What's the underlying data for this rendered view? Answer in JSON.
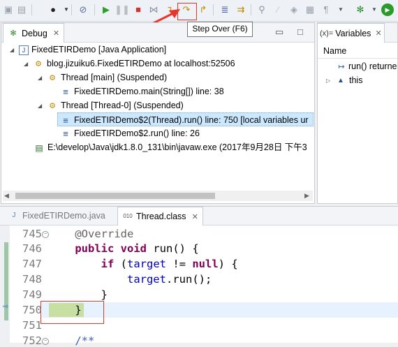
{
  "toolbar": {
    "tooltip": "Step Over (F6)",
    "icons": [
      "save-icon",
      "save-all-icon",
      "debug-perspective-icon",
      "dropdown-icon",
      "skip-breakpoints-icon",
      "resume-icon",
      "suspend-icon",
      "terminate-icon",
      "disconnect-icon",
      "step-into-icon",
      "step-over-icon",
      "step-return-icon",
      "drop-to-frame-icon",
      "breakpoint-icon",
      "external-tools-icon",
      "bug-icon",
      "run-icon"
    ]
  },
  "debug_view": {
    "tab_label": "Debug",
    "tree": [
      {
        "label": "FixedETIRDemo [Java Application]"
      },
      {
        "label": "blog.jizuiku6.FixedETIRDemo at localhost:52506"
      },
      {
        "label": "Thread [main] (Suspended)"
      },
      {
        "label": "FixedETIRDemo.main(String[]) line: 38"
      },
      {
        "label": "Thread [Thread-0] (Suspended)"
      },
      {
        "label": "FixedETIRDemo$2(Thread).run() line: 750 [local variables ur"
      },
      {
        "label": "FixedETIRDemo$2.run() line: 26"
      },
      {
        "label": "E:\\develop\\Java\\jdk1.8.0_131\\bin\\javaw.exe (2017年9月28日 下午3"
      }
    ]
  },
  "variables_view": {
    "tab_label": "Variables",
    "column_header": "Name",
    "rows": [
      {
        "label": "run() returne"
      },
      {
        "label": "this"
      }
    ]
  },
  "editor": {
    "tabs": [
      {
        "label": "FixedETIRDemo.java"
      },
      {
        "label": "Thread.class"
      }
    ],
    "lines": [
      {
        "num": "745",
        "text": "    @Override"
      },
      {
        "num": "746",
        "text": "    public void run() {"
      },
      {
        "num": "747",
        "text": "        if (target != null) {"
      },
      {
        "num": "748",
        "text": "            target.run();"
      },
      {
        "num": "749",
        "text": "        }"
      },
      {
        "num": "750",
        "text": "    }"
      },
      {
        "num": "751",
        "text": ""
      },
      {
        "num": "752",
        "text": "    /**"
      }
    ]
  },
  "colors": {
    "accent_red": "#e8362a",
    "selection": "#cce8ff",
    "current_line": "#e8f2fe",
    "highlight_green": "#c7dfa3"
  }
}
